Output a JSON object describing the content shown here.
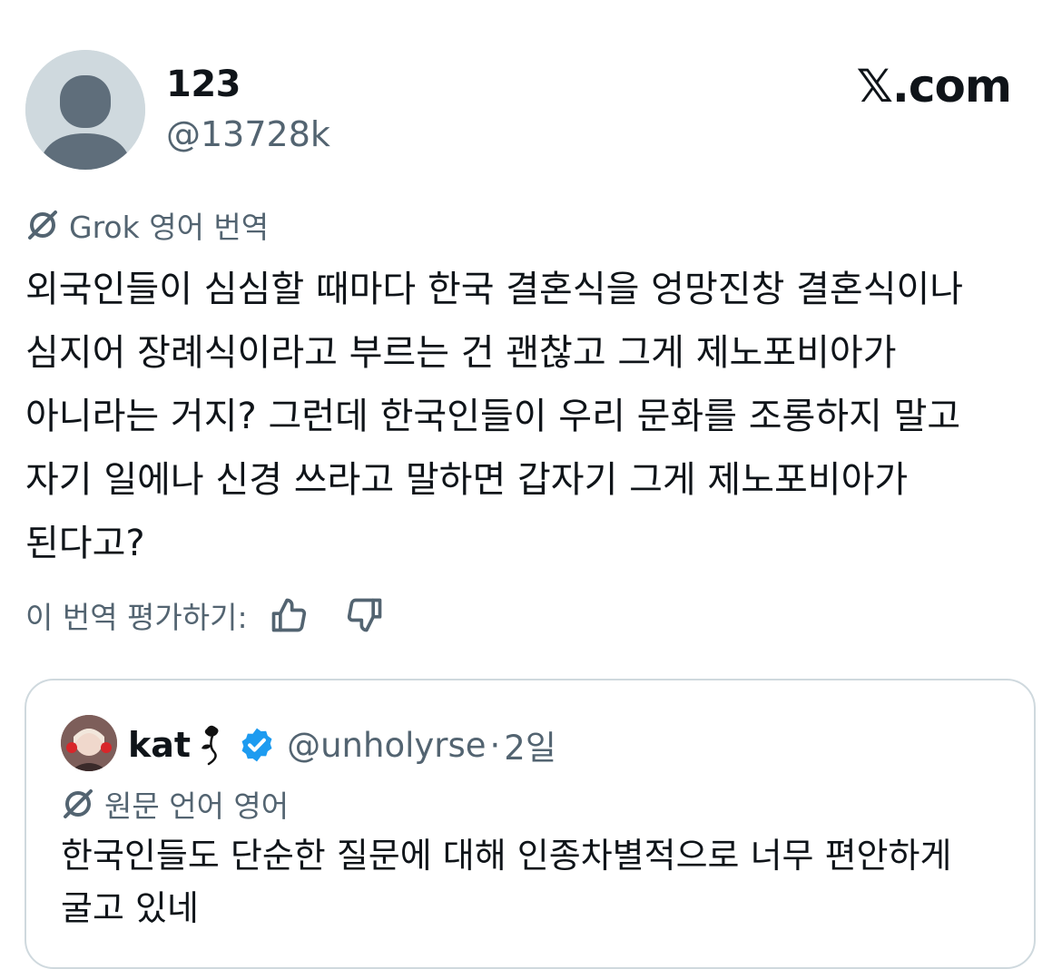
{
  "brand": {
    "label": "𝕏.com"
  },
  "author": {
    "display_name": "123",
    "handle": "@13728k",
    "avatar_icon": "default-avatar-icon"
  },
  "translation": {
    "label": "Grok 영어 번역",
    "icon": "grok-icon",
    "text": "외국인들이 심심할 때마다 한국 결혼식을 엉망진창 결혼식이나 심지어 장례식이라고 부르는 건 괜찮고 그게 제노포비아가 아니라는 거지? 그런데 한국인들이 우리 문화를 조롱하지 말고 자기 일에나 신경 쓰라고 말하면 갑자기 그게 제노포비아가 된다고?",
    "rate_label": "이 번역 평가하기:",
    "thumbs_up_icon": "thumbs-up-icon",
    "thumbs_down_icon": "thumbs-down-icon"
  },
  "quote": {
    "display_name": "kat",
    "name_emoji_icon": "rose-icon",
    "verified_icon": "verified-badge-icon",
    "handle": "@unholyrse",
    "separator": "·",
    "time": "2일",
    "original_language_label": "원문 언어 영어",
    "text": "한국인들도 단순한 질문에 대해 인종차별적으로 너무 편안하게 굴고 있네"
  },
  "colors": {
    "text": "#0f1419",
    "secondary": "#536471",
    "border": "#cfd9de",
    "verified": "#1d9bf0"
  }
}
